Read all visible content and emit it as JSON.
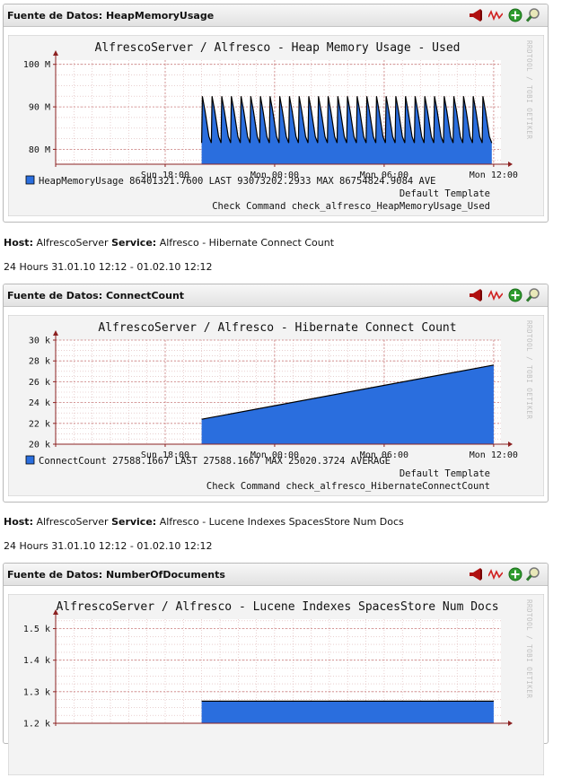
{
  "colors": {
    "area": "#2a6ede",
    "line": "#000000",
    "grid": "#dcb4b4",
    "canvas": "#ffffff",
    "frame": "#f3f3f3",
    "axis": "#8b2020"
  },
  "icons": [
    "alarm-horn-icon",
    "pnp-graph-icon",
    "add-basket-icon",
    "zoom-magnifier-icon"
  ],
  "graphs": [
    {
      "panel_title": "Fuente de Datos: HeapMemoryUsage",
      "chart_data": {
        "type": "area",
        "title": "AlfrescoServer / Alfresco - Heap Memory Usage - Used",
        "watermark": "RRDTOOL / TOBI OETIKER",
        "yticks": [
          "80 M",
          "90 M",
          "100 M"
        ],
        "ytick_values": [
          80,
          90,
          100
        ],
        "ylim": [
          76.5,
          101
        ],
        "xticks": [
          "Sun 18:00",
          "Mon 00:00",
          "Mon 06:00",
          "Mon 12:00"
        ],
        "xtick_hours": [
          6,
          12,
          18,
          24
        ],
        "xlim_hours": [
          0,
          24.4
        ],
        "data_start_hours": 8.0,
        "data_end_hours": 23.9,
        "pattern": "sawtooth",
        "cycles": 30,
        "low": 81.5,
        "high": 92.5,
        "legend": {
          "series": "HeapMemoryUsage",
          "line1": "86401321.7600   LAST    93073202.2933   MAX    86754824.9084   AVE"
        },
        "template_line": "Default Template",
        "command_line": "Check Command check_alfresco_HeapMemoryUsage_Used"
      }
    },
    {
      "panel_title": "Fuente de Datos: ConnectCount",
      "chart_data": {
        "type": "area",
        "title": "AlfrescoServer / Alfresco - Hibernate Connect Count",
        "watermark": "RRDTOOL / TOBI OETIKER",
        "yticks": [
          "20 k",
          "22 k",
          "24 k",
          "26 k",
          "28 k",
          "30 k"
        ],
        "ytick_values": [
          20,
          22,
          24,
          26,
          28,
          30
        ],
        "ylim": [
          20,
          30
        ],
        "xticks": [
          "Sun 18:00",
          "Mon 00:00",
          "Mon 06:00",
          "Mon 12:00"
        ],
        "xtick_hours": [
          6,
          12,
          18,
          24
        ],
        "xlim_hours": [
          0,
          24.4
        ],
        "data_start_hours": 8.0,
        "data_end_hours": 24.0,
        "pattern": "linear",
        "start_value": 22.4,
        "end_value": 27.6,
        "legend": {
          "series": "ConnectCount",
          "line1": "27588.1667   LAST    27588.1667   MAX    25020.3724   AVERAGE"
        },
        "template_line": "Default Template",
        "command_line": "Check Command check_alfresco_HibernateConnectCount"
      }
    },
    {
      "panel_title": "Fuente de Datos: NumberOfDocuments",
      "chart_data": {
        "type": "area",
        "title": "AlfrescoServer / Alfresco - Lucene Indexes SpacesStore Num Docs",
        "watermark": "RRDTOOL / TOBI OETIKER",
        "yticks": [
          "1.2 k",
          "1.3 k",
          "1.4 k",
          "1.5 k"
        ],
        "ytick_values": [
          1.2,
          1.3,
          1.4,
          1.5
        ],
        "ylim": [
          1.2,
          1.53
        ],
        "xticks": [],
        "xtick_hours": [],
        "xlim_hours": [
          0,
          24.4
        ],
        "data_start_hours": 8.0,
        "data_end_hours": 24.0,
        "pattern": "flat",
        "value": 1.27,
        "legend": {
          "series": "",
          "line1": ""
        },
        "template_line": "",
        "command_line": ""
      }
    }
  ],
  "info": [
    {
      "host_label": "Host:",
      "host": "AlfrescoServer",
      "service_label": "Service:",
      "service": "Alfresco - Hibernate Connect Count",
      "period": "24 Hours 31.01.10 12:12 - 01.02.10 12:12"
    },
    {
      "host_label": "Host:",
      "host": "AlfrescoServer",
      "service_label": "Service:",
      "service": "Alfresco - Lucene Indexes SpacesStore Num Docs",
      "period": "24 Hours 31.01.10 12:12 - 01.02.10 12:12"
    }
  ]
}
